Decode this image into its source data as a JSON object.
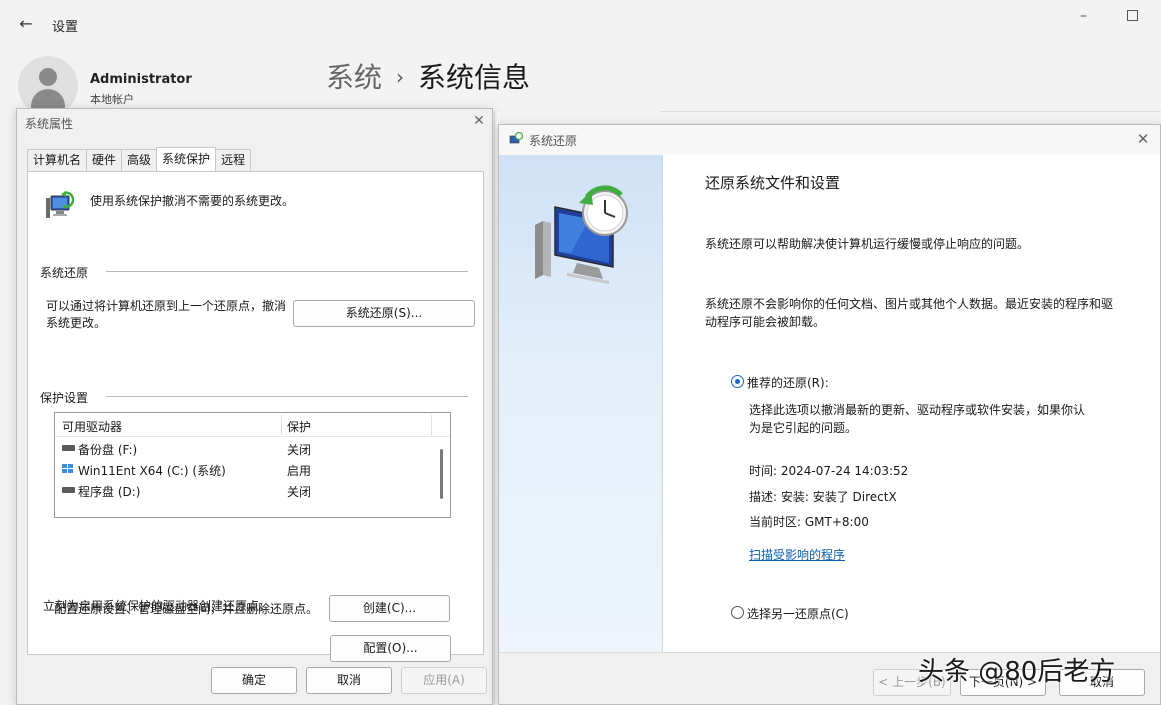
{
  "settings": {
    "title": "设置",
    "user_name": "Administrator",
    "user_type": "本地帐户",
    "breadcrumb_parent": "系统",
    "breadcrumb_separator": "›",
    "breadcrumb_current": "系统信息"
  },
  "sysprop": {
    "title": "系统属性",
    "tabs": [
      "计算机名",
      "硬件",
      "高级",
      "系统保护",
      "远程"
    ],
    "active_tab": "系统保护",
    "description": "使用系统保护撤消不需要的系统更改。",
    "restore_group": "系统还原",
    "restore_text": "可以通过将计算机还原到上一个还原点，撤消系统更改。",
    "restore_button": "系统还原(S)...",
    "protection_group": "保护设置",
    "drive_headers": [
      "可用驱动器",
      "保护"
    ],
    "drives": [
      {
        "name": "备份盘 (F:)",
        "protection": "关闭",
        "icon": "drive-icon"
      },
      {
        "name": "Win11Ent X64 (C:) (系统)",
        "protection": "启用",
        "icon": "windows-drive-icon"
      },
      {
        "name": "程序盘 (D:)",
        "protection": "关闭",
        "icon": "drive-icon"
      }
    ],
    "config_text": "配置还原设置、管理磁盘空间，并且删除还原点。",
    "config_button": "配置(O)...",
    "create_text": "立刻为启用系统保护的驱动器创建还原点。",
    "create_button": "创建(C)...",
    "ok_button": "确定",
    "cancel_button": "取消",
    "apply_button": "应用(A)"
  },
  "restore": {
    "title": "系统还原",
    "heading": "还原系统文件和设置",
    "para1": "系统还原可以帮助解决使计算机运行缓慢或停止响应的问题。",
    "para2": "系统还原不会影响你的任何文档、图片或其他个人数据。最近安装的程序和驱动程序可能会被卸载。",
    "option1_label": "推荐的还原(R):",
    "option1_desc": "选择此选项以撤消最新的更新、驱动程序或软件安装，如果你认为是它引起的问题。",
    "time": "时间: 2024-07-24 14:03:52",
    "description": "描述: 安装: 安装了 DirectX",
    "timezone": "当前时区: GMT+8:00",
    "scan_link": "扫描受影响的程序",
    "option2_label": "选择另一还原点(C)",
    "back_button": "< 上一步(B)",
    "next_button": "下一页(N) >",
    "cancel_button": "取消"
  },
  "watermark": "头条 @80后老方",
  "colors": {
    "accent": "#1766c4",
    "link": "#0a5fb0"
  }
}
